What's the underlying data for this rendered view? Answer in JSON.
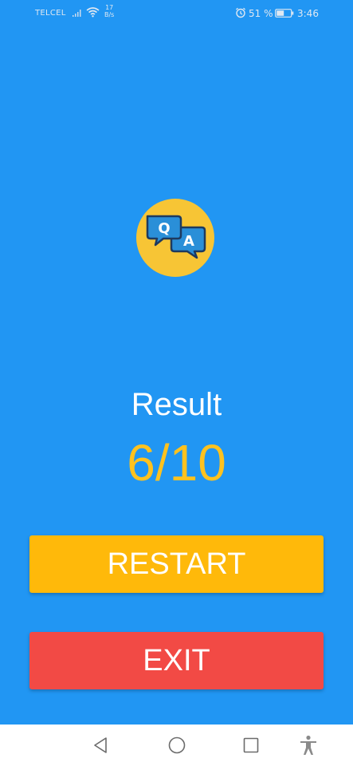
{
  "status_bar": {
    "carrier": "TELCEL",
    "net_speed_value": "17",
    "net_speed_unit": "B/s",
    "battery": "51 %",
    "time": "3:46"
  },
  "logo": {
    "letter_q": "Q",
    "letter_a": "A"
  },
  "result": {
    "label": "Result",
    "score": "6/10"
  },
  "buttons": {
    "restart": "RESTART",
    "exit": "EXIT"
  },
  "icons": {
    "signal": "signal-icon",
    "wifi": "wifi-icon",
    "alarm": "alarm-icon",
    "battery": "battery-icon",
    "back": "back-icon",
    "home": "home-icon",
    "recents": "recents-icon",
    "accessibility": "accessibility-icon"
  },
  "colors": {
    "background": "#2196F3",
    "accent_yellow": "#FFC21F",
    "restart_button": "#FFB90A",
    "exit_button": "#F24A45"
  }
}
